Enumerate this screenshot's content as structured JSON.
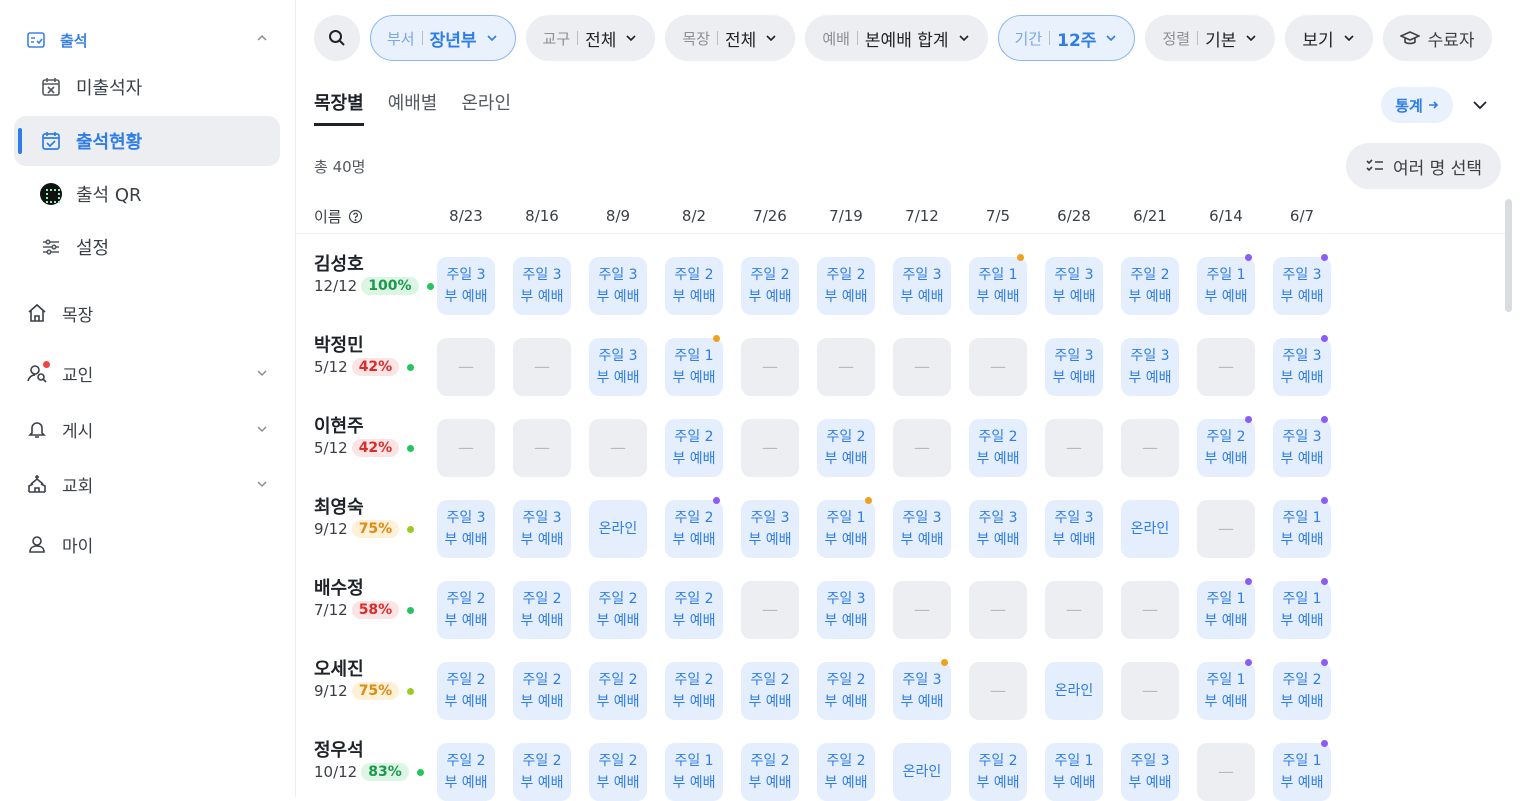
{
  "sidebar": {
    "group": "출석",
    "sub_items": [
      {
        "label": "미출석자",
        "active": false
      },
      {
        "label": "출석현황",
        "active": true
      },
      {
        "label": "출석 QR",
        "active": false
      },
      {
        "label": "설정",
        "active": false
      }
    ],
    "main_items": [
      "목장",
      "교인",
      "게시",
      "교회",
      "마이"
    ]
  },
  "filters": {
    "dept_label": "부서",
    "dept_value": "장년부",
    "district_label": "교구",
    "district_value": "전체",
    "cell_label": "목장",
    "cell_value": "전체",
    "worship_label": "예배",
    "worship_value": "본예배 합계",
    "period_label": "기간",
    "period_value": "12주",
    "sort_label": "정렬",
    "sort_value": "기본",
    "view_label": "보기",
    "graduate_label": "수료자"
  },
  "tabs": [
    "목장별",
    "예배별",
    "온라인"
  ],
  "stats_button": "통계",
  "total": "총 40명",
  "multi_select": "여러 명 선택",
  "name_column": "이름",
  "dates": [
    "8/23",
    "8/16",
    "8/9",
    "8/2",
    "7/26",
    "7/19",
    "7/12",
    "7/5",
    "6/28",
    "6/21",
    "6/14",
    "6/7"
  ],
  "colors": {
    "accent": "#2f7de6",
    "mark_orange": "#f0a020",
    "mark_purple": "#8b5cf6",
    "dot_green": "#22c55e",
    "dot_yellowgreen": "#9ccc20"
  },
  "people": [
    {
      "name": "김성호",
      "count": "12/12",
      "pct": "100%",
      "tone": "green",
      "dot": "#22c55e",
      "cells": [
        {
          "l1": "주일 3",
          "l2": "부 예배",
          "mark": ""
        },
        {
          "l1": "주일 3",
          "l2": "부 예배",
          "mark": ""
        },
        {
          "l1": "주일 3",
          "l2": "부 예배",
          "mark": ""
        },
        {
          "l1": "주일 2",
          "l2": "부 예배",
          "mark": ""
        },
        {
          "l1": "주일 2",
          "l2": "부 예배",
          "mark": ""
        },
        {
          "l1": "주일 2",
          "l2": "부 예배",
          "mark": ""
        },
        {
          "l1": "주일 3",
          "l2": "부 예배",
          "mark": ""
        },
        {
          "l1": "주일 1",
          "l2": "부 예배",
          "mark": "orange"
        },
        {
          "l1": "주일 3",
          "l2": "부 예배",
          "mark": ""
        },
        {
          "l1": "주일 2",
          "l2": "부 예배",
          "mark": ""
        },
        {
          "l1": "주일 1",
          "l2": "부 예배",
          "mark": "purple"
        },
        {
          "l1": "주일 3",
          "l2": "부 예배",
          "mark": "purple"
        }
      ]
    },
    {
      "name": "박정민",
      "count": "5/12",
      "pct": "42%",
      "tone": "red",
      "dot": "#22c55e",
      "cells": [
        {
          "absent": true,
          "l1": "—"
        },
        {
          "absent": true,
          "l1": "—"
        },
        {
          "l1": "주일 3",
          "l2": "부 예배",
          "mark": ""
        },
        {
          "l1": "주일 1",
          "l2": "부 예배",
          "mark": "orange"
        },
        {
          "absent": true,
          "l1": "—"
        },
        {
          "absent": true,
          "l1": "—"
        },
        {
          "absent": true,
          "l1": "—"
        },
        {
          "absent": true,
          "l1": "—"
        },
        {
          "l1": "주일 3",
          "l2": "부 예배",
          "mark": ""
        },
        {
          "l1": "주일 3",
          "l2": "부 예배",
          "mark": ""
        },
        {
          "absent": true,
          "l1": "—"
        },
        {
          "l1": "주일 3",
          "l2": "부 예배",
          "mark": "purple"
        }
      ]
    },
    {
      "name": "이현주",
      "count": "5/12",
      "pct": "42%",
      "tone": "red",
      "dot": "#22c55e",
      "cells": [
        {
          "absent": true,
          "l1": "—"
        },
        {
          "absent": true,
          "l1": "—"
        },
        {
          "absent": true,
          "l1": "—"
        },
        {
          "l1": "주일 2",
          "l2": "부 예배",
          "mark": ""
        },
        {
          "absent": true,
          "l1": "—"
        },
        {
          "l1": "주일 2",
          "l2": "부 예배",
          "mark": ""
        },
        {
          "absent": true,
          "l1": "—"
        },
        {
          "l1": "주일 2",
          "l2": "부 예배",
          "mark": ""
        },
        {
          "absent": true,
          "l1": "—"
        },
        {
          "absent": true,
          "l1": "—"
        },
        {
          "l1": "주일 2",
          "l2": "부 예배",
          "mark": "purple"
        },
        {
          "l1": "주일 3",
          "l2": "부 예배",
          "mark": "purple"
        }
      ]
    },
    {
      "name": "최영숙",
      "count": "9/12",
      "pct": "75%",
      "tone": "orange",
      "dot": "#9ccc20",
      "cells": [
        {
          "l1": "주일 3",
          "l2": "부 예배",
          "mark": ""
        },
        {
          "l1": "주일 3",
          "l2": "부 예배",
          "mark": ""
        },
        {
          "l1": "온라인",
          "l2": "",
          "mark": ""
        },
        {
          "l1": "주일 2",
          "l2": "부 예배",
          "mark": "purple"
        },
        {
          "l1": "주일 3",
          "l2": "부 예배",
          "mark": ""
        },
        {
          "l1": "주일 1",
          "l2": "부 예배",
          "mark": "orange"
        },
        {
          "l1": "주일 3",
          "l2": "부 예배",
          "mark": ""
        },
        {
          "l1": "주일 3",
          "l2": "부 예배",
          "mark": ""
        },
        {
          "l1": "주일 3",
          "l2": "부 예배",
          "mark": ""
        },
        {
          "l1": "온라인",
          "l2": "",
          "mark": ""
        },
        {
          "absent": true,
          "l1": "—"
        },
        {
          "l1": "주일 1",
          "l2": "부 예배",
          "mark": "purple"
        }
      ]
    },
    {
      "name": "배수정",
      "count": "7/12",
      "pct": "58%",
      "tone": "red",
      "dot": "#22c55e",
      "cells": [
        {
          "l1": "주일 2",
          "l2": "부 예배",
          "mark": ""
        },
        {
          "l1": "주일 2",
          "l2": "부 예배",
          "mark": ""
        },
        {
          "l1": "주일 2",
          "l2": "부 예배",
          "mark": ""
        },
        {
          "l1": "주일 2",
          "l2": "부 예배",
          "mark": ""
        },
        {
          "absent": true,
          "l1": "—"
        },
        {
          "l1": "주일 3",
          "l2": "부 예배",
          "mark": ""
        },
        {
          "absent": true,
          "l1": "—"
        },
        {
          "absent": true,
          "l1": "—"
        },
        {
          "absent": true,
          "l1": "—"
        },
        {
          "absent": true,
          "l1": "—"
        },
        {
          "l1": "주일 1",
          "l2": "부 예배",
          "mark": "purple"
        },
        {
          "l1": "주일 1",
          "l2": "부 예배",
          "mark": "purple"
        }
      ]
    },
    {
      "name": "오세진",
      "count": "9/12",
      "pct": "75%",
      "tone": "orange",
      "dot": "#9ccc20",
      "cells": [
        {
          "l1": "주일 2",
          "l2": "부 예배",
          "mark": ""
        },
        {
          "l1": "주일 2",
          "l2": "부 예배",
          "mark": ""
        },
        {
          "l1": "주일 2",
          "l2": "부 예배",
          "mark": ""
        },
        {
          "l1": "주일 2",
          "l2": "부 예배",
          "mark": ""
        },
        {
          "l1": "주일 2",
          "l2": "부 예배",
          "mark": ""
        },
        {
          "l1": "주일 2",
          "l2": "부 예배",
          "mark": ""
        },
        {
          "l1": "주일 3",
          "l2": "부 예배",
          "mark": "orange"
        },
        {
          "absent": true,
          "l1": "—"
        },
        {
          "l1": "온라인",
          "l2": "",
          "mark": ""
        },
        {
          "absent": true,
          "l1": "—"
        },
        {
          "l1": "주일 1",
          "l2": "부 예배",
          "mark": "purple"
        },
        {
          "l1": "주일 2",
          "l2": "부 예배",
          "mark": "purple"
        }
      ]
    },
    {
      "name": "정우석",
      "count": "10/12",
      "pct": "83%",
      "tone": "green",
      "dot": "#22c55e",
      "cells": [
        {
          "l1": "주일 2",
          "l2": "부 예배",
          "mark": ""
        },
        {
          "l1": "주일 2",
          "l2": "부 예배",
          "mark": ""
        },
        {
          "l1": "주일 2",
          "l2": "부 예배",
          "mark": ""
        },
        {
          "l1": "주일 1",
          "l2": "부 예배",
          "mark": ""
        },
        {
          "l1": "주일 2",
          "l2": "부 예배",
          "mark": ""
        },
        {
          "l1": "주일 2",
          "l2": "부 예배",
          "mark": ""
        },
        {
          "l1": "온라인",
          "l2": "",
          "mark": ""
        },
        {
          "l1": "주일 2",
          "l2": "부 예배",
          "mark": ""
        },
        {
          "l1": "주일 1",
          "l2": "부 예배",
          "mark": ""
        },
        {
          "l1": "주일 3",
          "l2": "부 예배",
          "mark": ""
        },
        {
          "absent": true,
          "l1": "—"
        },
        {
          "l1": "주일 1",
          "l2": "부 예배",
          "mark": "purple"
        }
      ]
    }
  ]
}
